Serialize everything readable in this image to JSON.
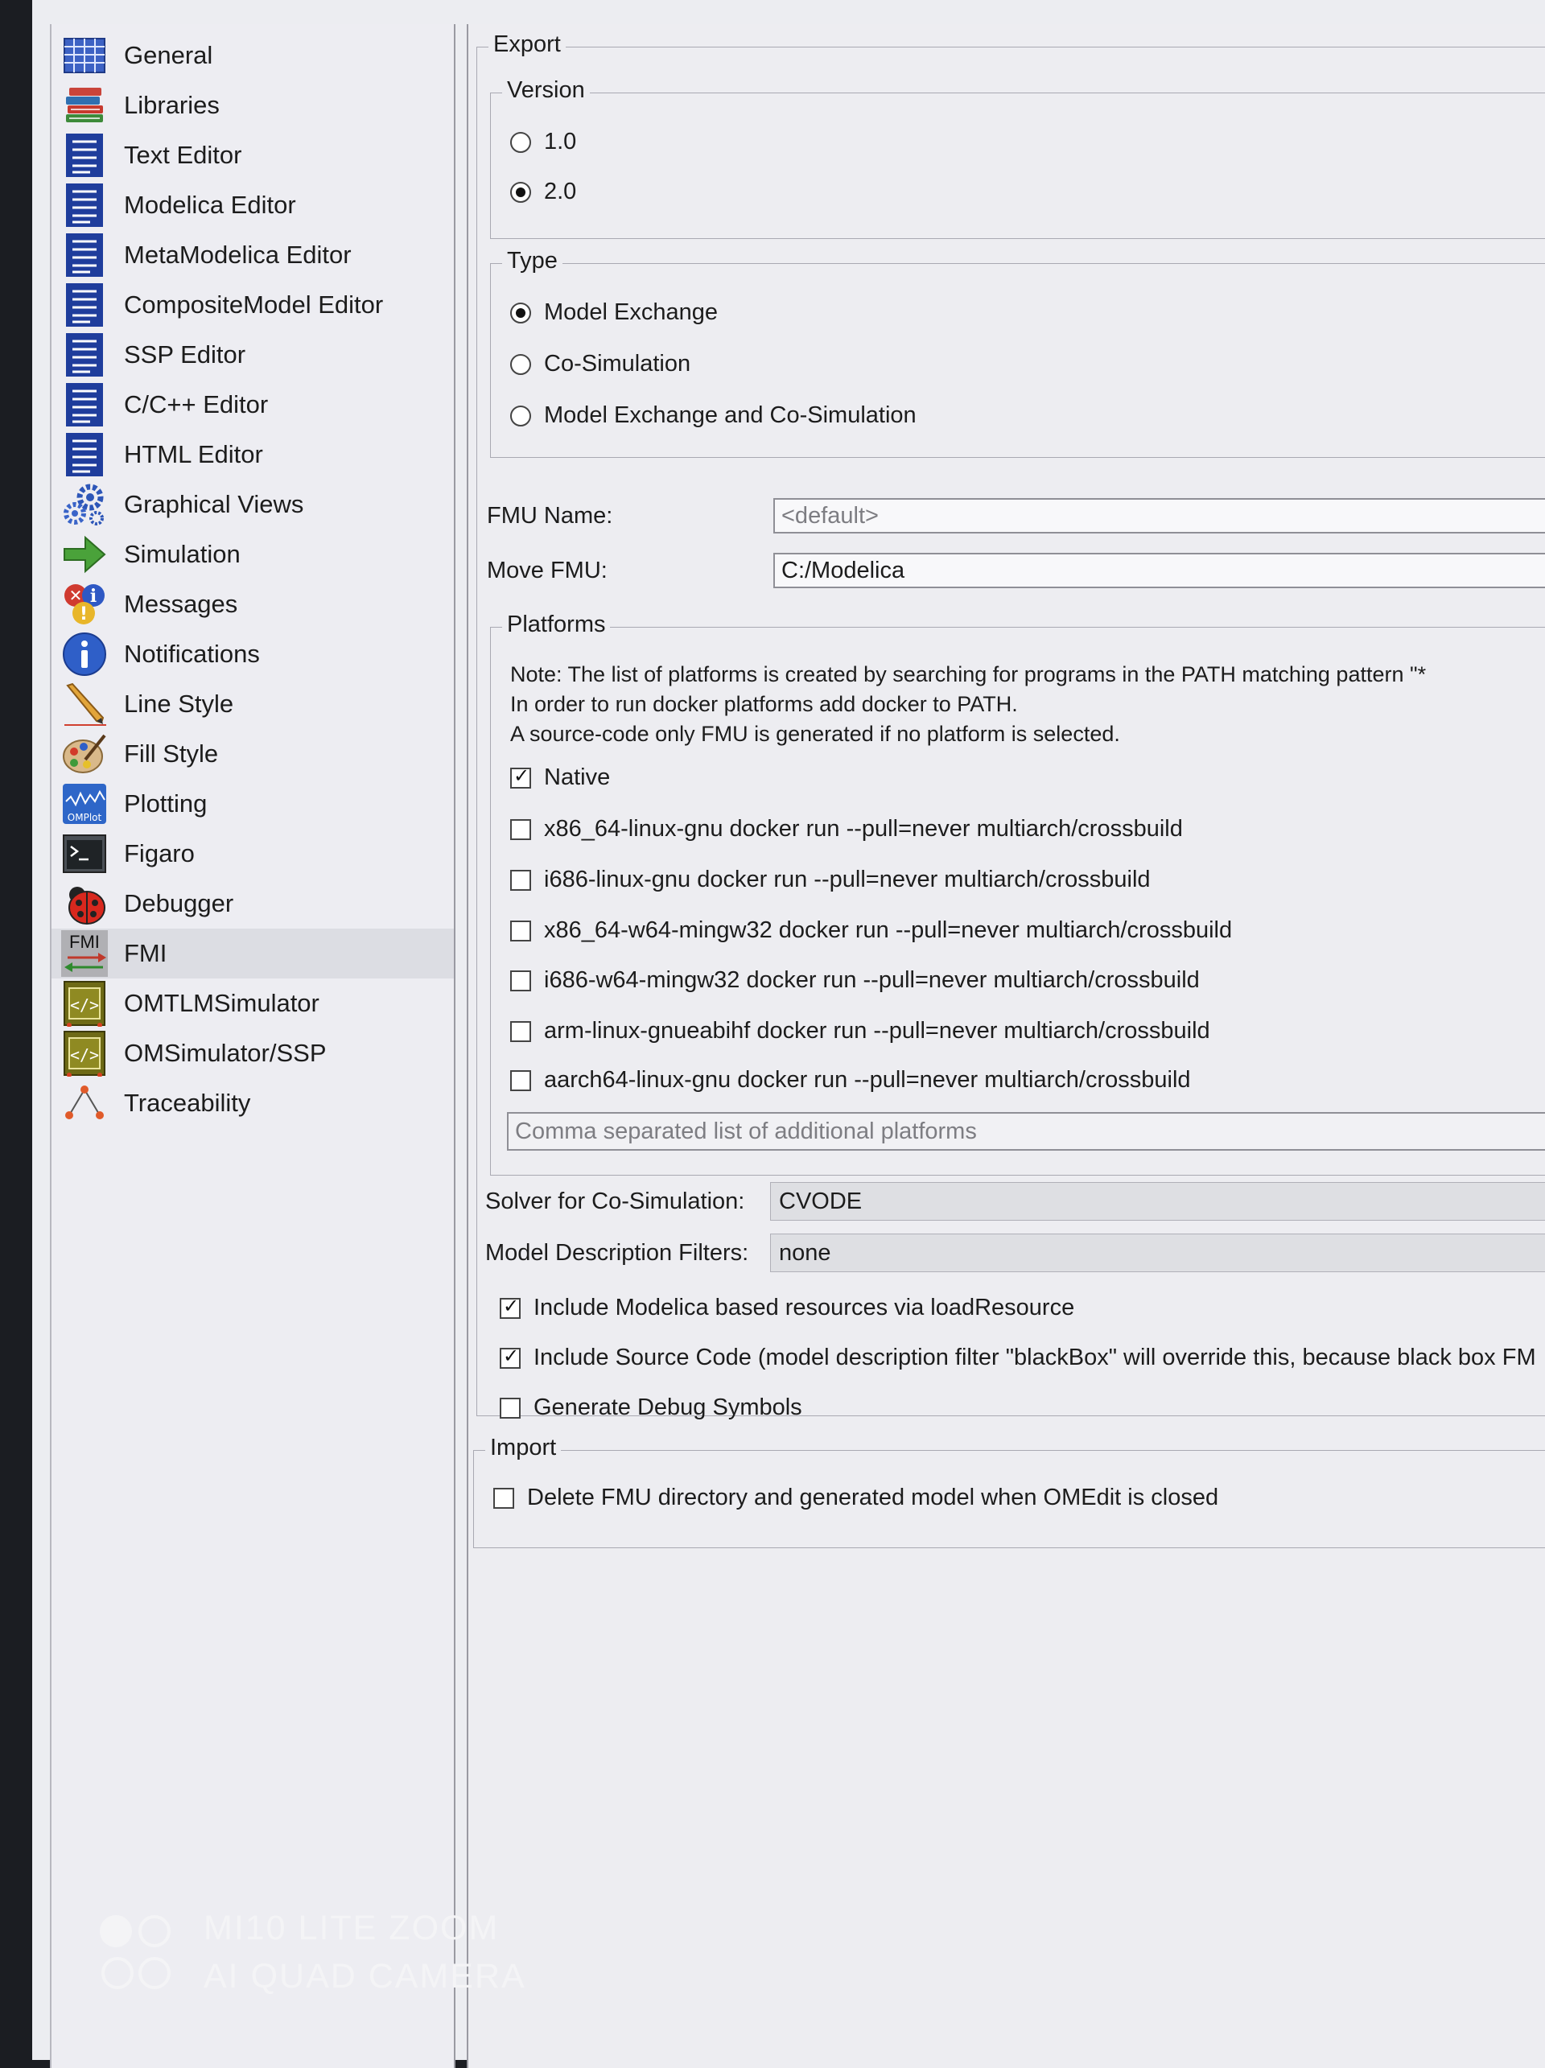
{
  "sidebar": {
    "items": [
      {
        "label": "General",
        "icon": "table-grid-icon"
      },
      {
        "label": "Libraries",
        "icon": "books-icon"
      },
      {
        "label": "Text Editor",
        "icon": "text-document-icon"
      },
      {
        "label": "Modelica Editor",
        "icon": "text-document-icon"
      },
      {
        "label": "MetaModelica Editor",
        "icon": "text-document-icon"
      },
      {
        "label": "CompositeModel Editor",
        "icon": "text-document-icon"
      },
      {
        "label": "SSP Editor",
        "icon": "text-document-icon"
      },
      {
        "label": "C/C++ Editor",
        "icon": "text-document-icon"
      },
      {
        "label": "HTML Editor",
        "icon": "text-document-icon"
      },
      {
        "label": "Graphical Views",
        "icon": "gears-icon"
      },
      {
        "label": "Simulation",
        "icon": "green-arrow-icon"
      },
      {
        "label": "Messages",
        "icon": "messages-icon"
      },
      {
        "label": "Notifications",
        "icon": "info-icon"
      },
      {
        "label": "Line Style",
        "icon": "pencil-icon"
      },
      {
        "label": "Fill Style",
        "icon": "palette-icon"
      },
      {
        "label": "Plotting",
        "icon": "omplot-icon",
        "icon_text": "OMPlot"
      },
      {
        "label": "Figaro",
        "icon": "terminal-icon"
      },
      {
        "label": "Debugger",
        "icon": "ladybug-icon"
      },
      {
        "label": "FMI",
        "icon": "fmi-icon",
        "icon_text": "FMI",
        "selected": true
      },
      {
        "label": "OMTLMSimulator",
        "icon": "code-chip-icon"
      },
      {
        "label": "OMSimulator/SSP",
        "icon": "code-chip-icon"
      },
      {
        "label": "Traceability",
        "icon": "traceability-icon"
      }
    ]
  },
  "export": {
    "title": "Export",
    "version": {
      "title": "Version",
      "options": [
        {
          "label": "1.0",
          "checked": false
        },
        {
          "label": "2.0",
          "checked": true
        }
      ]
    },
    "type": {
      "title": "Type",
      "options": [
        {
          "label": "Model Exchange",
          "checked": true
        },
        {
          "label": "Co-Simulation",
          "checked": false
        },
        {
          "label": "Model Exchange and Co-Simulation",
          "checked": false
        }
      ]
    },
    "fmu_name": {
      "label": "FMU Name:",
      "value": "",
      "placeholder": "<default>"
    },
    "move_fmu": {
      "label": "Move FMU:",
      "value": "C:/Modelica"
    },
    "platforms": {
      "title": "Platforms",
      "note_lines": [
        "Note: The list of platforms is created by searching for programs in the PATH matching pattern \"*",
        "In order to run docker platforms add docker to PATH.",
        "A source-code only FMU is generated if no platform is selected."
      ],
      "options": [
        {
          "label": "Native",
          "checked": true
        },
        {
          "label": "x86_64-linux-gnu docker run --pull=never multiarch/crossbuild",
          "checked": false
        },
        {
          "label": "i686-linux-gnu docker run --pull=never multiarch/crossbuild",
          "checked": false
        },
        {
          "label": "x86_64-w64-mingw32 docker run --pull=never multiarch/crossbuild",
          "checked": false
        },
        {
          "label": "i686-w64-mingw32 docker run --pull=never multiarch/crossbuild",
          "checked": false
        },
        {
          "label": "arm-linux-gnueabihf docker run --pull=never multiarch/crossbuild",
          "checked": false
        },
        {
          "label": "aarch64-linux-gnu docker run --pull=never multiarch/crossbuild",
          "checked": false
        }
      ],
      "additional": {
        "value": "",
        "placeholder": "Comma separated list of additional platforms"
      }
    },
    "solver": {
      "label": "Solver for Co-Simulation:",
      "value": "CVODE"
    },
    "filters": {
      "label": "Model Description Filters:",
      "value": "none"
    },
    "options": [
      {
        "label": "Include Modelica based resources via loadResource",
        "checked": true
      },
      {
        "label": "Include Source Code (model description filter \"blackBox\" will override this, because black box FM",
        "checked": true
      },
      {
        "label": "Generate Debug Symbols",
        "checked": false
      }
    ]
  },
  "import": {
    "title": "Import",
    "options": [
      {
        "label": "Delete FMU directory and generated model when OMEdit is closed",
        "checked": false
      }
    ]
  },
  "watermark": {
    "line1": "MI10 LITE ZOOM",
    "line2": "AI QUAD CAMERA"
  }
}
